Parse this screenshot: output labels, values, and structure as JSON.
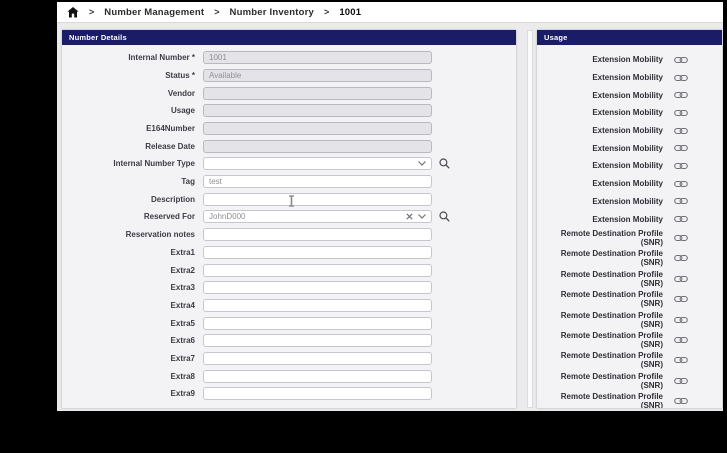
{
  "colors": {
    "header_navy": "#1a1c66",
    "frame_black": "#000000",
    "panel_bg": "#f3f3f5",
    "disabled_field_bg": "#e3e3e8",
    "value_text": "#8f8f97"
  },
  "breadcrumb": {
    "separator": ">",
    "items": [
      {
        "label": "Number Management"
      },
      {
        "label": "Number Inventory"
      },
      {
        "label": "1001"
      }
    ]
  },
  "number_details": {
    "title": "Number Details",
    "fields": [
      {
        "label": "Internal Number *",
        "value": "1001",
        "type": "disabled"
      },
      {
        "label": "Status *",
        "value": "Available",
        "type": "disabled"
      },
      {
        "label": "Vendor",
        "value": "",
        "type": "disabled"
      },
      {
        "label": "Usage",
        "value": "",
        "type": "disabled"
      },
      {
        "label": "E164Number",
        "value": "",
        "type": "disabled"
      },
      {
        "label": "Release Date",
        "value": "",
        "type": "disabled"
      },
      {
        "label": "Internal Number Type",
        "value": "",
        "type": "select",
        "search": true
      },
      {
        "label": "Tag",
        "value": "test",
        "type": "text"
      },
      {
        "label": "Description",
        "value": "",
        "type": "text",
        "cursor": true
      },
      {
        "label": "Reserved For",
        "value": "JohnD000",
        "type": "select",
        "search": true,
        "clearable": true
      },
      {
        "label": "Reservation notes",
        "value": "",
        "type": "text"
      },
      {
        "label": "Extra1",
        "value": "",
        "type": "text"
      },
      {
        "label": "Extra2",
        "value": "",
        "type": "text"
      },
      {
        "label": "Extra3",
        "value": "",
        "type": "text"
      },
      {
        "label": "Extra4",
        "value": "",
        "type": "text"
      },
      {
        "label": "Extra5",
        "value": "",
        "type": "text"
      },
      {
        "label": "Extra6",
        "value": "",
        "type": "text"
      },
      {
        "label": "Extra7",
        "value": "",
        "type": "text"
      },
      {
        "label": "Extra8",
        "value": "",
        "type": "text"
      },
      {
        "label": "Extra9",
        "value": "",
        "type": "text"
      }
    ]
  },
  "usage": {
    "title": "Usage",
    "items": [
      {
        "lines": [
          "Extension Mobility"
        ]
      },
      {
        "lines": [
          "Extension Mobility"
        ]
      },
      {
        "lines": [
          "Extension Mobility"
        ]
      },
      {
        "lines": [
          "Extension Mobility"
        ]
      },
      {
        "lines": [
          "Extension Mobility"
        ]
      },
      {
        "lines": [
          "Extension Mobility"
        ]
      },
      {
        "lines": [
          "Extension Mobility"
        ]
      },
      {
        "lines": [
          "Extension Mobility"
        ]
      },
      {
        "lines": [
          "Extension Mobility"
        ]
      },
      {
        "lines": [
          "Extension Mobility"
        ]
      },
      {
        "lines": [
          "Remote Destination Profile",
          "(SNR)"
        ]
      },
      {
        "lines": [
          "Remote Destination Profile",
          "(SNR)"
        ]
      },
      {
        "lines": [
          "Remote Destination Profile",
          "(SNR)"
        ]
      },
      {
        "lines": [
          "Remote Destination Profile",
          "(SNR)"
        ]
      },
      {
        "lines": [
          "Remote Destination Profile",
          "(SNR)"
        ]
      },
      {
        "lines": [
          "Remote Destination Profile",
          "(SNR)"
        ]
      },
      {
        "lines": [
          "Remote Destination Profile",
          "(SNR)"
        ]
      },
      {
        "lines": [
          "Remote Destination Profile",
          "(SNR)"
        ]
      },
      {
        "lines": [
          "Remote Destination Profile",
          "(SNR)"
        ]
      }
    ]
  }
}
